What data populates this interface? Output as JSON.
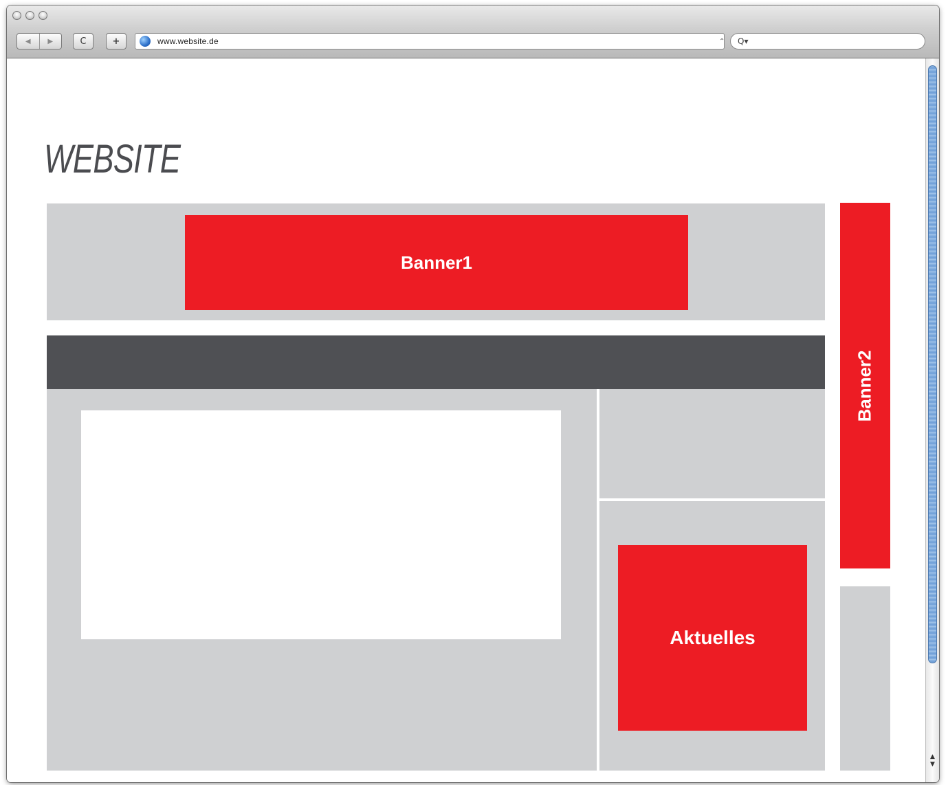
{
  "browser": {
    "address": "www.website.de",
    "nav_back_glyph": "◀",
    "nav_forward_glyph": "▶",
    "reload_glyph": "C",
    "add_glyph": "+",
    "search_glyph": "Q▾",
    "snapback_glyph": "⌃"
  },
  "page": {
    "logo": "WEBSITE",
    "banner1": "Banner1",
    "banner2": "Banner2",
    "aktuelles": "Aktuelles"
  },
  "colors": {
    "accent_red": "#ed1c24",
    "panel_grey": "#cfd0d2",
    "nav_dark": "#4f5054",
    "logo_text": "#4b4c50"
  },
  "icons": [
    "back-icon",
    "forward-icon",
    "reload-icon",
    "add-bookmark-icon",
    "globe-icon",
    "search-icon",
    "scroll-up-icon",
    "scroll-down-icon"
  ]
}
